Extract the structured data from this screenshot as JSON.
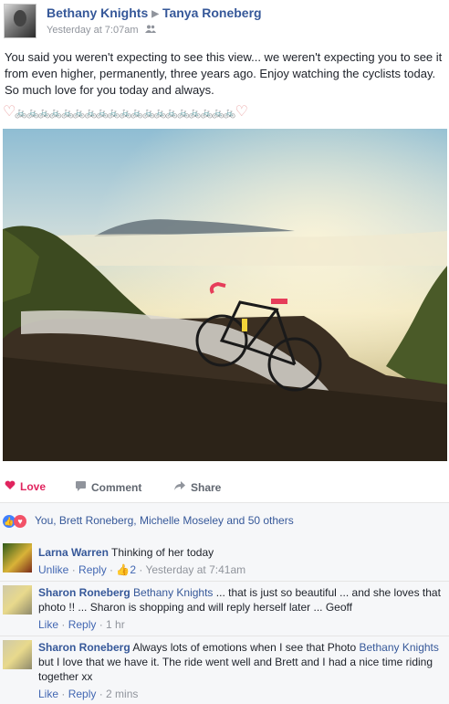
{
  "post": {
    "author": "Bethany Knights",
    "recipient": "Tanya Roneberg",
    "arrow": "▶",
    "timestamp": "Yesterday at 7:07am",
    "privacy_icon": "friends-icon",
    "text": "You said you weren't expecting to see this view... we weren't expecting you to see it from even higher, permanently, three years ago. Enjoy watching the cyclists today. So much love for you today and always.",
    "emoji_heart": "♡",
    "emoji_bikes": "🚲🚲🚲🚲🚲🚲🚲🚲🚲🚲🚲🚲🚲🚲🚲🚲🚲🚲🚲"
  },
  "actions": {
    "love": "Love",
    "comment": "Comment",
    "share": "Share"
  },
  "reactions": {
    "summary": "You, Brett Roneberg, Michelle Moseley and 50 others"
  },
  "comments": [
    {
      "name": "Larna Warren",
      "tag": "",
      "text": "Thinking of her today",
      "action1": "Unlike",
      "action2": "Reply",
      "likes": "2",
      "time": "Yesterday at 7:41am"
    },
    {
      "name": "Sharon Roneberg",
      "tag": "Bethany Knights",
      "text": "... that is just so beautiful ... and she loves that photo !! ... Sharon is shopping and will reply herself later ... Geoff",
      "action1": "Like",
      "action2": "Reply",
      "time": "1 hr"
    },
    {
      "name": "Sharon Roneberg",
      "tag": "Bethany Knights",
      "text_pre": "Always lots of emotions when I see that Photo ",
      "text_post": " but I love that we have it. The ride went well and Brett and I had a nice time riding together xx",
      "action1": "Like",
      "action2": "Reply",
      "time": "2 mins"
    }
  ],
  "colors": {
    "link": "#365899",
    "love": "#e0245e",
    "muted": "#90949c"
  }
}
